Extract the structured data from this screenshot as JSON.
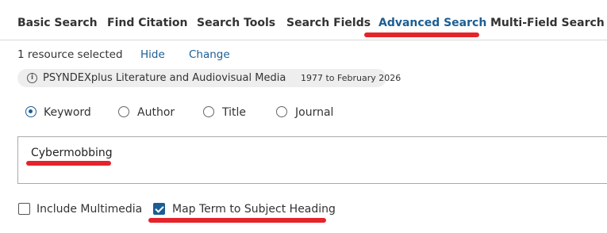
{
  "tabs": [
    {
      "label": "Basic Search"
    },
    {
      "label": "Find Citation"
    },
    {
      "label": "Search Tools"
    },
    {
      "label": "Search Fields"
    },
    {
      "label": "Advanced Search",
      "active": true
    },
    {
      "label": "Multi-Field Search"
    }
  ],
  "resources": {
    "selected_text": "1 resource selected",
    "hide_link": "Hide",
    "change_link": "Change",
    "database_name": "PSYNDEXplus Literature and Audiovisual Media",
    "database_range": "1977 to February 2026"
  },
  "search_type": {
    "options": [
      {
        "label": "Keyword",
        "selected": true
      },
      {
        "label": "Author",
        "selected": false
      },
      {
        "label": "Title",
        "selected": false
      },
      {
        "label": "Journal",
        "selected": false
      }
    ]
  },
  "search_input": {
    "value": "Cybermobbing"
  },
  "options": {
    "include_multimedia": {
      "label": "Include Multimedia",
      "checked": false
    },
    "map_term": {
      "label": "Map Term to Subject Heading",
      "checked": true
    }
  },
  "colors": {
    "accent": "#1c5e94",
    "highlight": "#e5232a"
  },
  "icons": {
    "info": "info-icon"
  }
}
